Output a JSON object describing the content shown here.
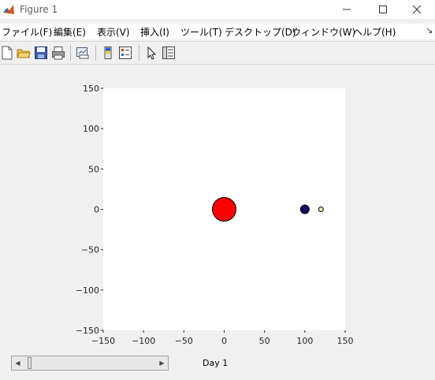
{
  "window": {
    "title": "Figure 1",
    "controls": {
      "minimize": "—",
      "maximize": "☐",
      "close": "✕"
    }
  },
  "menu": [
    "ファイル(F)",
    "編集(E)",
    "表示(V)",
    "挿入(I)",
    "ツール(T)",
    "デスクトップ(D)",
    "ウィンドウ(W)",
    "ヘルプ(H)"
  ],
  "toolbar": {
    "icons": [
      "new-figure-icon",
      "open-file-icon",
      "save-icon",
      "print-icon",
      "link-plot-icon",
      "colorbar-icon",
      "legend-icon",
      "pointer-icon",
      "property-inspector-icon"
    ]
  },
  "chart_data": {
    "type": "scatter",
    "xlim": [
      -150,
      150
    ],
    "ylim": [
      -150,
      150
    ],
    "xticks": [
      -150,
      -100,
      -50,
      0,
      50,
      100,
      150
    ],
    "yticks": [
      -150,
      -100,
      -50,
      0,
      50,
      100,
      150
    ],
    "xtick_labels": [
      "−150",
      "−100",
      "−50",
      "0",
      "50",
      "100",
      "150"
    ],
    "ytick_labels": [
      "−150",
      "−100",
      "−50",
      "0",
      "50",
      "100",
      "150"
    ],
    "grid": false,
    "points": [
      {
        "x": 0,
        "y": 0,
        "size": "large",
        "color": "#ff0000"
      },
      {
        "x": 100,
        "y": 0,
        "size": "medium",
        "color": "#0a0a5c"
      },
      {
        "x": 120,
        "y": 0,
        "size": "small",
        "color": "#f2e6b3"
      }
    ]
  },
  "slider": {
    "value": 1,
    "min": 1
  },
  "day_label": "Day 1"
}
